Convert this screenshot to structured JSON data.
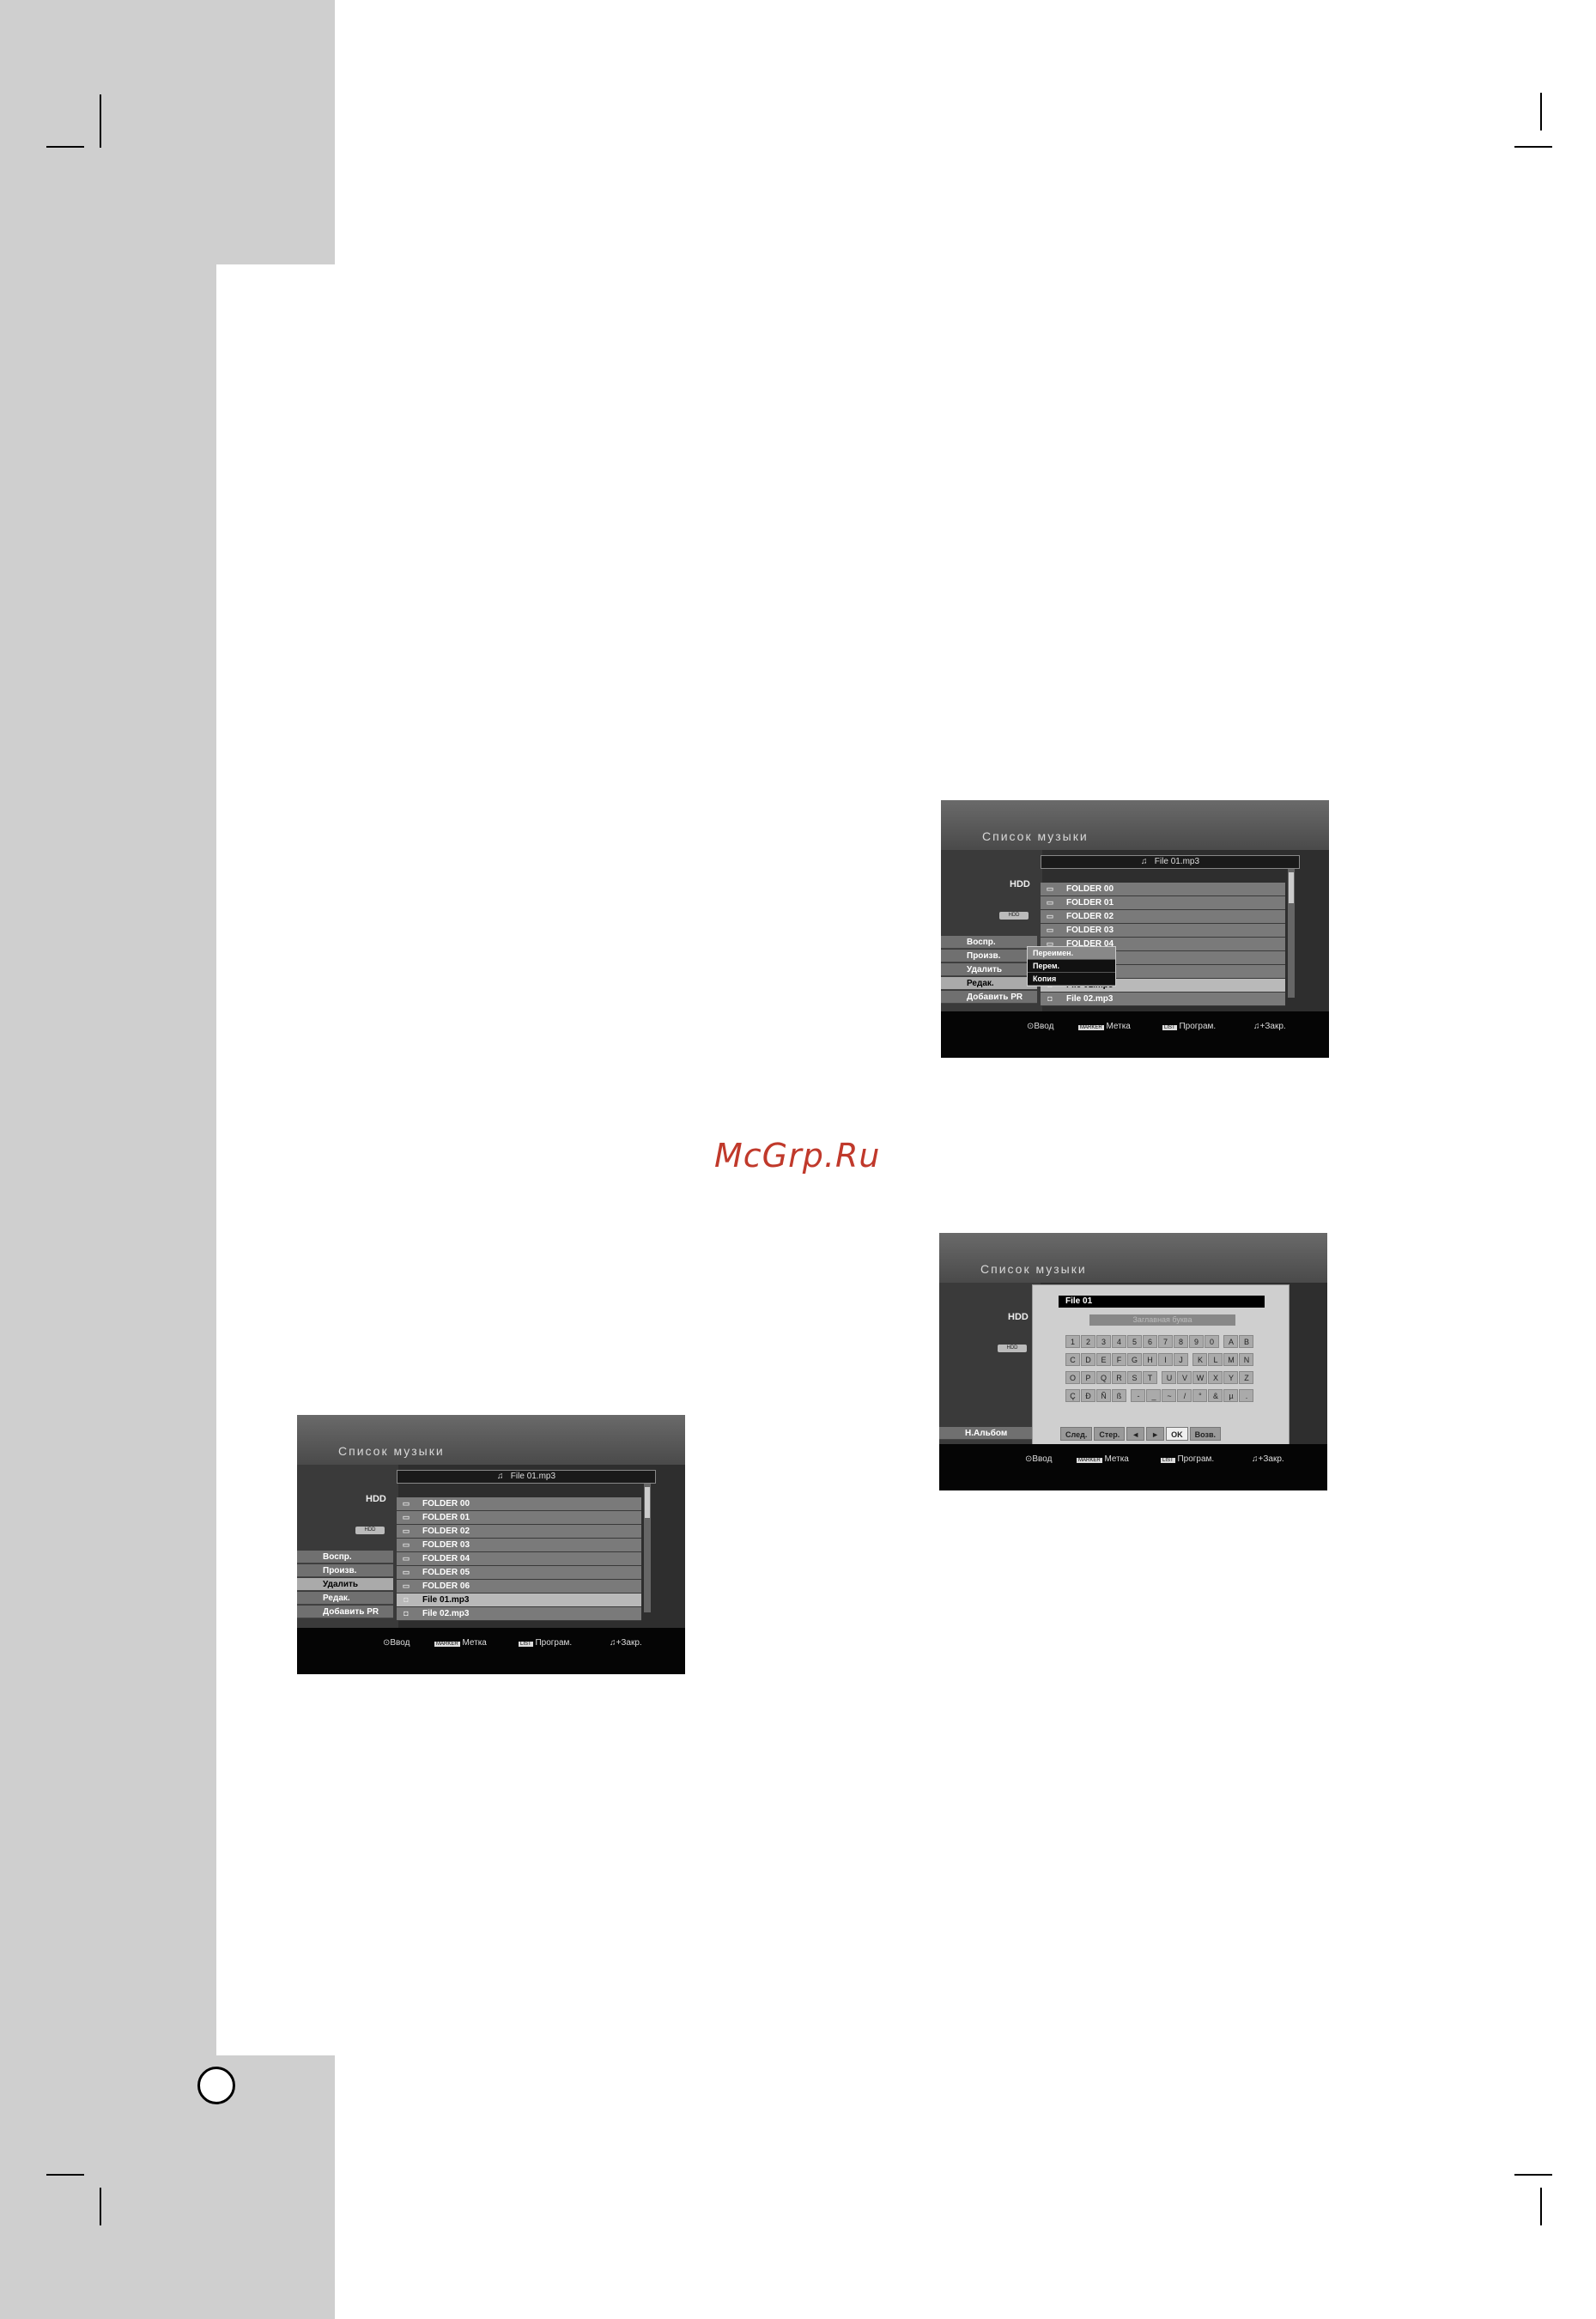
{
  "watermark": "McGrp.Ru",
  "screen": {
    "title": "Список музыки",
    "device": "HDD",
    "path": "File 01.mp3",
    "menu": [
      "Воспр.",
      "Произв.",
      "Удалить",
      "Редак.",
      "Добавить PR"
    ],
    "rows": [
      "FOLDER 00",
      "FOLDER 01",
      "FOLDER 02",
      "FOLDER 03",
      "FOLDER 04",
      "FOLDER 05",
      "FOLDER 06",
      "File 01.mp3",
      "File 02.mp3"
    ],
    "footer": {
      "enter": "Ввод",
      "mark": "Метка",
      "program": "Програм.",
      "close": "Закр."
    },
    "key_marker": "MARKER",
    "key_list": "LIST"
  },
  "popup": [
    "Переимен.",
    "Перем.",
    "Копия"
  ],
  "keyboard": {
    "input_value": "File 01",
    "charset": "Заглавная буква",
    "keys": [
      "1",
      "2",
      "3",
      "4",
      "5",
      "6",
      "7",
      "8",
      "9",
      "0",
      "A",
      "B",
      "C",
      "D",
      "E",
      "F",
      "G",
      "H",
      "I",
      "J",
      "K",
      "L",
      "M",
      "N",
      "O",
      "P",
      "Q",
      "R",
      "S",
      "T",
      "U",
      "V",
      "W",
      "X",
      "Y",
      "Z",
      "Ç",
      "Ð",
      "Ñ",
      "ß",
      "-",
      "_",
      "~",
      "/",
      "°",
      "&",
      "µ",
      "."
    ],
    "buttons": [
      "След.",
      "Стер.",
      "◄",
      "►",
      "OK",
      "Возв."
    ],
    "new_album": "Н.Альбом"
  }
}
